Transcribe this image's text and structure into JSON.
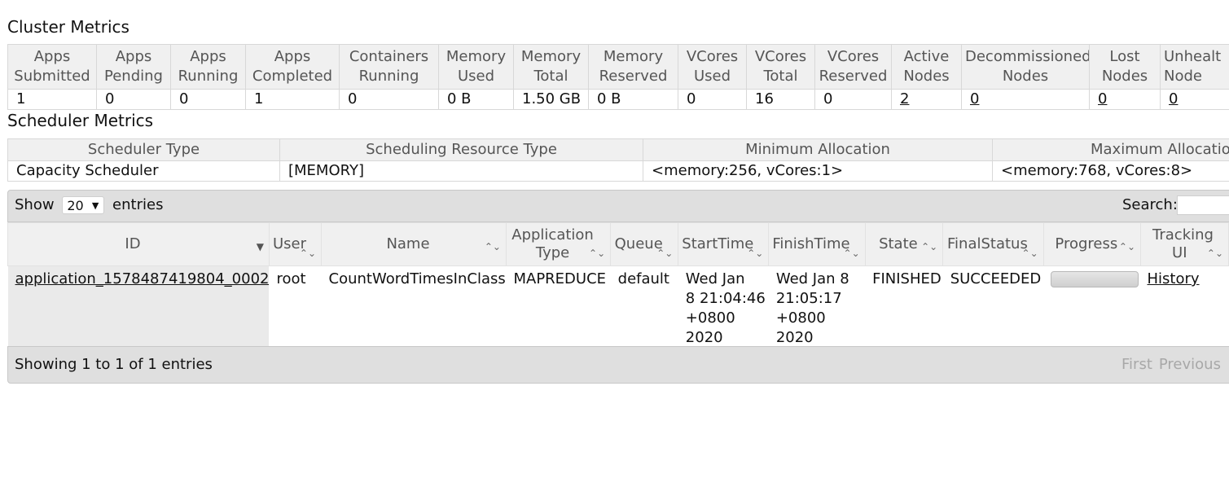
{
  "cluster": {
    "title": "Cluster Metrics",
    "headers": [
      [
        "Apps",
        "Submitted"
      ],
      [
        "Apps",
        "Pending"
      ],
      [
        "Apps",
        "Running"
      ],
      [
        "Apps",
        "Completed"
      ],
      [
        "Containers",
        "Running"
      ],
      [
        "Memory",
        "Used"
      ],
      [
        "Memory",
        "Total"
      ],
      [
        "Memory",
        "Reserved"
      ],
      [
        "VCores",
        "Used"
      ],
      [
        "VCores",
        "Total"
      ],
      [
        "VCores",
        "Reserved"
      ],
      [
        "Active",
        "Nodes"
      ],
      [
        "Decommissioned",
        "Nodes"
      ],
      [
        "Lost",
        "Nodes"
      ],
      [
        "Unhealt",
        "Node"
      ]
    ],
    "values": [
      "1",
      "0",
      "0",
      "1",
      "0",
      "0 B",
      "1.50 GB",
      "0 B",
      "0",
      "16",
      "0",
      "2",
      "0",
      "0",
      "0"
    ]
  },
  "scheduler": {
    "title": "Scheduler Metrics",
    "headers": [
      "Scheduler Type",
      "Scheduling Resource Type",
      "Minimum Allocation",
      "Maximum Allocatio"
    ],
    "values": [
      "Capacity Scheduler",
      "[MEMORY]",
      "<memory:256, vCores:1>",
      "<memory:768, vCores:8>"
    ]
  },
  "apps_toolbar": {
    "show": "Show",
    "page_length": "20",
    "entries": "entries",
    "search_label": "Search:"
  },
  "apps_table": {
    "headers": [
      "ID",
      [
        "User",
        ""
      ],
      "Name",
      [
        "Application",
        "Type"
      ],
      [
        "Queue",
        ""
      ],
      [
        "StartTime",
        ""
      ],
      [
        "FinishTime",
        ""
      ],
      "State",
      [
        "FinalStatus",
        ""
      ],
      "Progress",
      [
        "Tracking",
        "UI"
      ]
    ],
    "row": {
      "id": "application_1578487419804_0002",
      "user": "root",
      "name": "CountWordTimesInClass",
      "type": "MAPREDUCE",
      "queue": "default",
      "start": [
        "Wed Jan",
        "8 21:04:46",
        "+0800",
        "2020"
      ],
      "finish": [
        "Wed Jan 8",
        "21:05:17",
        "+0800",
        "2020"
      ],
      "state": "FINISHED",
      "final_status": "SUCCEEDED",
      "progress": 0,
      "tracking": "History"
    }
  },
  "footer": {
    "info": "Showing 1 to 1 of 1 entries",
    "first": "First",
    "previous": "Previous"
  }
}
